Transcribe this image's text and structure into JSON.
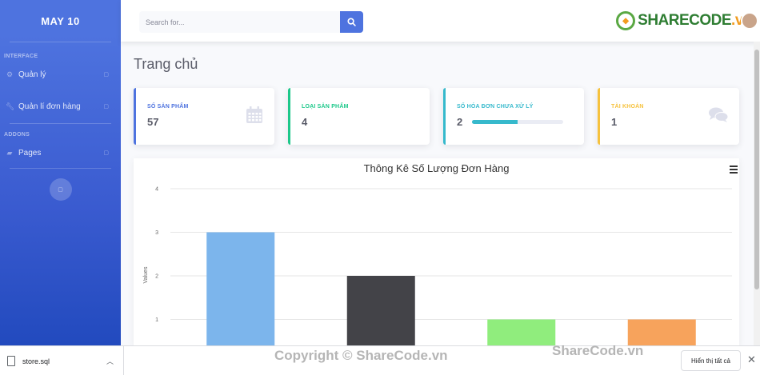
{
  "sidebar": {
    "brand": "MAY 10",
    "heading_interface": "INTERFACE",
    "heading_addons": "ADDONS",
    "items": [
      {
        "label": "Quản lý",
        "icon": "gear-icon"
      },
      {
        "label": "Quản lí đơn hàng",
        "icon": "wrench-icon"
      },
      {
        "label": "Pages",
        "icon": "folder-icon"
      }
    ]
  },
  "topbar": {
    "search_placeholder": "Search for...",
    "logo_text_1": "SHARECODE",
    "logo_text_2": ".vn"
  },
  "page": {
    "title": "Trang chủ"
  },
  "cards": [
    {
      "label": "SỐ SẢN PHẨM",
      "value": "57",
      "color": "#4e73df",
      "icon": "calendar-icon"
    },
    {
      "label": "LOẠI SẢN PHẨM",
      "value": "4",
      "color": "#1cc88a",
      "icon": ""
    },
    {
      "label": "SỐ HÓA ĐƠN CHƯA XỬ LÝ",
      "value": "2",
      "color": "#36b9cc",
      "icon": "",
      "progress": 0.5
    },
    {
      "label": "TÀI KHOẢN",
      "value": "1",
      "color": "#f6c23e",
      "icon": "comments-icon"
    }
  ],
  "chart_data": {
    "type": "bar",
    "title": "Thông Kê Số Lượng Đơn Hàng",
    "ylabel": "Values",
    "ylim": [
      0,
      4
    ],
    "yticks": [
      "1",
      "2",
      "3",
      "4"
    ],
    "values": [
      3,
      2,
      1,
      1
    ],
    "colors": [
      "#7cb5ec",
      "#434348",
      "#90ed7d",
      "#f7a35c"
    ],
    "grid": true
  },
  "downloads": {
    "file": "store.sql",
    "show_all": "Hiển thị tất cả"
  },
  "watermark": {
    "center": "Copyright © ShareCode.vn",
    "right": "ShareCode.vn"
  }
}
